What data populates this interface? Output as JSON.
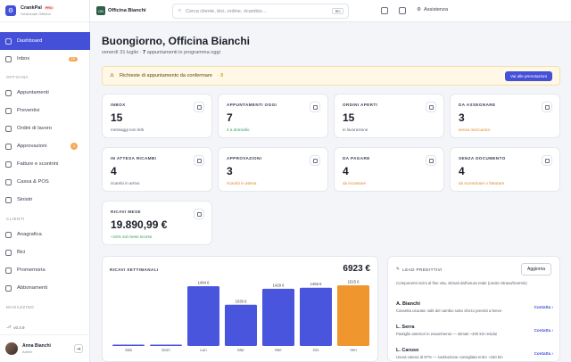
{
  "brand": {
    "name": "CrankPal",
    "badge": "PRO",
    "sub": "Gestionale Officina"
  },
  "topbar": {
    "shop_name": "Officina Bianchi",
    "logo_initials": "OB",
    "search_placeholder": "Cerca cliente, bici, ordine, ricambio…",
    "search_shortcut": "⌘K",
    "help_label": "Assistenza"
  },
  "sidebar": {
    "items": [
      {
        "label": "Dashboard",
        "icon": "grid-icon"
      },
      {
        "label": "Inbox",
        "badge": "15",
        "icon": "inbox-icon"
      }
    ],
    "sections": [
      {
        "title": "OFFICINA",
        "items": [
          {
            "label": "Appuntamenti"
          },
          {
            "label": "Preventivi"
          },
          {
            "label": "Ordini di lavoro"
          },
          {
            "label": "Approvazioni",
            "badge": "3"
          },
          {
            "label": "Fatture e scontrini"
          },
          {
            "label": "Cassa & POS"
          },
          {
            "label": "Sinistri"
          }
        ]
      },
      {
        "title": "CLIENTI",
        "items": [
          {
            "label": "Anagrafica"
          },
          {
            "label": "Bici"
          },
          {
            "label": "Promemoria"
          },
          {
            "label": "Abbonamenti"
          }
        ]
      },
      {
        "title": "MAGAZZINO",
        "items": []
      }
    ],
    "version": "v0.4.9",
    "user": {
      "name": "Anna Bianchi",
      "role": "Admin"
    }
  },
  "main": {
    "greeting": "Buongiorno, Officina Bianchi",
    "date": "venerdì 31 luglio ·",
    "appointments_count": "7",
    "appointments_text": "appuntamenti in programma oggi",
    "alert": {
      "text": "Richieste di appuntamento da confermare",
      "count": "· 8",
      "button": "Vai alle prenotazioni"
    },
    "cards": [
      {
        "label": "INBOX",
        "value": "15",
        "sub": "messaggi non letti",
        "tone": "grey"
      },
      {
        "label": "APPUNTAMENTI OGGI",
        "value": "7",
        "sub": "4 a domicilio",
        "tone": "green"
      },
      {
        "label": "ORDINI APERTI",
        "value": "15",
        "sub": "in lavorazione",
        "tone": "grey"
      },
      {
        "label": "DA ASSEGNARE",
        "value": "3",
        "sub": "senza meccanico",
        "tone": "orange"
      },
      {
        "label": "IN ATTESA RICAMBI",
        "value": "4",
        "sub": "ricambi in arrivo",
        "tone": "grey"
      },
      {
        "label": "APPROVAZIONI",
        "value": "3",
        "sub": "ricambi in attesa",
        "tone": "orange"
      },
      {
        "label": "DA PAGARE",
        "value": "4",
        "sub": "da incassare",
        "tone": "orange"
      },
      {
        "label": "SENZA DOCUMENTO",
        "value": "4",
        "sub": "da scontrinare o fatturare",
        "tone": "orange"
      },
      {
        "label": "RICAVI MESE",
        "value": "19.890,99 €",
        "sub": "+15% sul mese scorso",
        "tone": "green"
      }
    ],
    "leads": {
      "title": "LEAD PREDITTIVI",
      "refresh": "Aggiorna",
      "description": "Componenti vicini al fine vita, stimati dall'usura reale (uscite Strava/Garmin)",
      "items": [
        {
          "name": "A. Bianchi",
          "note": "Cassetta usurata: salti del cambio sotto sforzo previsti a breve",
          "action": "Contatta ›"
        },
        {
          "name": "L. Serra",
          "note": "Pastiglie anteriori in esaurimento — stimati ~200 km residui",
          "action": "Contatta ›"
        },
        {
          "name": "L. Caruso",
          "note": "Usura catena al 97% — sostituzione consigliata entro ~150 km",
          "action": "Contatta ›"
        }
      ]
    }
  },
  "chart_data": {
    "type": "bar",
    "title": "RICAVI SETTIMANALI",
    "total": "6923 €",
    "categories": [
      "Sab",
      "Dom",
      "Lun",
      "Mar",
      "Mer",
      "Gio",
      "Ven"
    ],
    "values": [
      0,
      0,
      1494,
      1030,
      1429,
      1455,
      1515
    ],
    "labels": [
      "",
      "",
      "1494 €",
      "1030 €",
      "1429 €",
      "1455 €",
      "1515 €"
    ],
    "highlight_index": 6,
    "colors": {
      "bar": "#4a55dd",
      "highlight": "#f0962e"
    },
    "ylim": [
      0,
      1515
    ]
  }
}
